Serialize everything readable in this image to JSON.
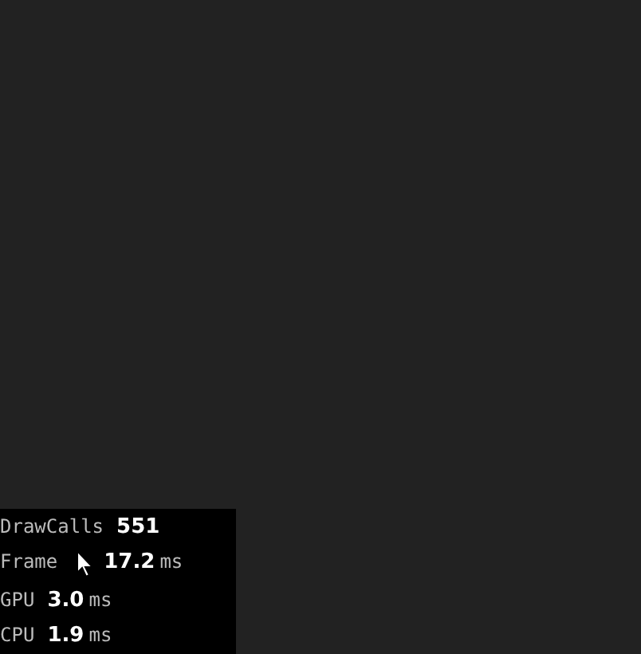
{
  "stats": [
    {
      "label": "DrawCalls",
      "value": "551"
    },
    {
      "label": "Frame",
      "value": "17.2",
      "unit": "ms"
    },
    {
      "label": "GPU",
      "value": "3.0",
      "unit": "ms"
    },
    {
      "label": "CPU",
      "value": "1.9",
      "unit": "ms"
    }
  ]
}
